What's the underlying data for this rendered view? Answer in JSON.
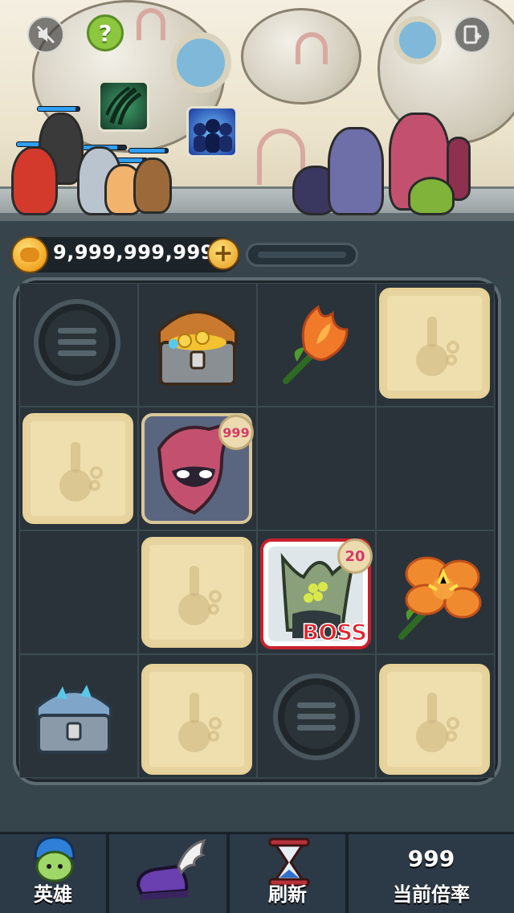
{
  "header": {
    "sound_button_icon": "muted-speaker-icon",
    "help_button_label": "?",
    "share_button_icon": "add-page-icon",
    "skills": [
      {
        "icon": "claw-slash-icon",
        "color": "#2f7f52"
      },
      {
        "icon": "shadow-clone-icon",
        "color": "#3b6fd8"
      }
    ]
  },
  "gold": {
    "amount": "9,999,999,999",
    "add_label": "+",
    "coin_icon": "gold-coin-icon"
  },
  "board": {
    "badges": {
      "pink_villain": "999",
      "boss": "20"
    },
    "boss_label": "BOSS",
    "colors": {
      "slot": "#efdfae",
      "boss_frame": "#c8202c",
      "badge_text": "#d23b6a"
    }
  },
  "nav": {
    "heroes_label": "英雄",
    "refresh_label": "刷新",
    "multiplier_value": "999",
    "multiplier_label": "当前倍率"
  }
}
